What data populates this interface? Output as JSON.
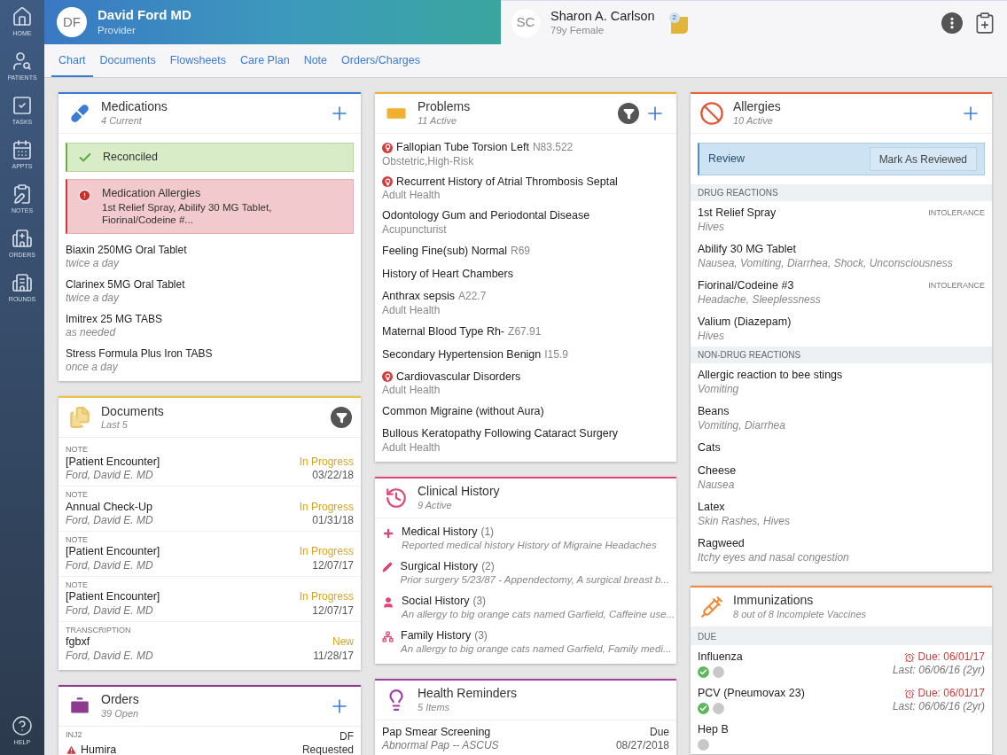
{
  "nav": {
    "items": [
      {
        "label": "HOME",
        "kind": "home"
      },
      {
        "label": "PATIENTS",
        "kind": "patients"
      },
      {
        "label": "TASKS",
        "kind": "tasks"
      },
      {
        "label": "APPTS",
        "kind": "appts"
      },
      {
        "label": "NOTES",
        "kind": "notes"
      },
      {
        "label": "ORDERS",
        "kind": "orders"
      },
      {
        "label": "ROUNDS",
        "kind": "rounds"
      }
    ],
    "help": "HELP"
  },
  "provider": {
    "initials": "DF",
    "name": "David Ford MD",
    "role": "Provider"
  },
  "patient": {
    "initials": "SC",
    "name": "Sharon A. Carlson",
    "info": "79y Female",
    "note_count": "2"
  },
  "tabs": [
    {
      "label": "Chart",
      "selected": true
    },
    {
      "label": "Documents",
      "selected": false
    },
    {
      "label": "Flowsheets",
      "selected": false
    },
    {
      "label": "Care Plan",
      "selected": false
    },
    {
      "label": "Note",
      "selected": false
    },
    {
      "label": "Orders/Charges",
      "selected": false
    }
  ],
  "medications": {
    "title": "Medications",
    "subtitle": "4 Current",
    "banners": [
      {
        "kind": "success",
        "title": "Reconciled"
      },
      {
        "kind": "alert",
        "title": "Medication Allergies",
        "text": "1st Relief Spray, Abilify 30 MG Tablet, Fiorinal/Codeine #..."
      }
    ],
    "items": [
      {
        "name": "Biaxin 250MG Oral Tablet",
        "sig": "twice a day"
      },
      {
        "name": "Clarinex 5MG Oral Tablet",
        "sig": "twice a day"
      },
      {
        "name": "Imitrex 25 MG TABS",
        "sig": "as needed"
      },
      {
        "name": "Stress Formula Plus Iron TABS",
        "sig": "once a day"
      }
    ]
  },
  "documents": {
    "title": "Documents",
    "subtitle": "Last 5",
    "items": [
      {
        "type": "NOTE",
        "title": "[Patient Encounter]",
        "status": "In Progress",
        "author": "Ford, David E. MD",
        "date": "03/22/18"
      },
      {
        "type": "NOTE",
        "title": "Annual Check-Up",
        "status": "In Progress",
        "author": "Ford, David E. MD",
        "date": "01/31/18"
      },
      {
        "type": "NOTE",
        "title": "[Patient Encounter]",
        "status": "In Progress",
        "author": "Ford, David E. MD",
        "date": "12/07/17"
      },
      {
        "type": "NOTE",
        "title": "[Patient Encounter]",
        "status": "In Progress",
        "author": "Ford, David E. MD",
        "date": "12/07/17"
      },
      {
        "type": "TRANSCRIPTION",
        "title": "fgbxf",
        "status": "New",
        "author": "Ford, David E. MD",
        "date": "11/28/17"
      }
    ]
  },
  "orders": {
    "title": "Orders",
    "subtitle": "39 Open",
    "items": [
      {
        "type": "INJ2",
        "initials": "DF",
        "name": "Humira",
        "status": "Requested"
      }
    ]
  },
  "problems": {
    "title": "Problems",
    "subtitle": "11 Active",
    "items": [
      {
        "name": "Fallopian Tube Torsion Left",
        "code": "N83.522",
        "category": "Obstetric,High-Risk",
        "flagged": true
      },
      {
        "name": "Recurrent History of Atrial Thrombosis Septal",
        "category": "Adult Health",
        "flagged": true
      },
      {
        "name": "Odontology Gum and Periodontal Disease",
        "category": "Acupuncturist",
        "flagged": false
      },
      {
        "name": "Feeling Fine(sub) Normal",
        "code": "R69",
        "flagged": false
      },
      {
        "name": "History of Heart Chambers",
        "flagged": false
      },
      {
        "name": "Anthrax sepsis",
        "code": "A22.7",
        "category": "Adult Health",
        "flagged": false
      },
      {
        "name": "Maternal Blood Type Rh-",
        "code": "Z67.91",
        "flagged": false
      },
      {
        "name": "Secondary Hypertension Benign",
        "code": "I15.9",
        "flagged": false
      },
      {
        "name": "Cardiovascular Disorders",
        "category": "Adult Health",
        "flagged": true
      },
      {
        "name": "Common Migraine (without Aura)",
        "flagged": false
      },
      {
        "name": "Bullous Keratopathy Following Cataract Surgery",
        "category": "Adult Health",
        "flagged": false
      }
    ]
  },
  "clinical_history": {
    "title": "Clinical History",
    "subtitle": "9 Active",
    "items": [
      {
        "kind": "medical",
        "name": "Medical History",
        "count": "(1)",
        "detail": "Reported medical history History of Migraine Headaches"
      },
      {
        "kind": "surgical",
        "name": "Surgical History",
        "count": "(2)",
        "detail": "Prior surgery 5/23/87 - Appendectomy, A surgical breast b..."
      },
      {
        "kind": "social",
        "name": "Social History",
        "count": "(3)",
        "detail": "An allergy to big orange cats named Garfield, Caffeine use..."
      },
      {
        "kind": "family",
        "name": "Family History",
        "count": "(3)",
        "detail": "An allergy to big orange cats named Garfield, Family medi..."
      }
    ]
  },
  "health_reminders": {
    "title": "Health Reminders",
    "subtitle": "5 Items",
    "items": [
      {
        "name": "Pap Smear Screening",
        "status": "Due",
        "detail": "Abnormal Pap -- ASCUS",
        "date": "08/27/2018"
      }
    ]
  },
  "allergies": {
    "title": "Allergies",
    "subtitle": "10 Active",
    "review": {
      "label": "Review",
      "button": "Mark As Reviewed"
    },
    "groups": [
      {
        "heading": "DRUG REACTIONS",
        "items": [
          {
            "name": "1st Relief Spray",
            "reaction": "Hives",
            "tag": "INTOLERANCE"
          },
          {
            "name": "Abilify 30 MG Tablet",
            "reaction": "Nausea, Vomiting, Diarrhea, Shock, Unconsciousness"
          },
          {
            "name": "Fiorinal/Codeine #3",
            "reaction": "Headache, Sleeplessness",
            "tag": "INTOLERANCE"
          },
          {
            "name": "Valium (Diazepam)",
            "reaction": "Hives"
          }
        ]
      },
      {
        "heading": "NON-DRUG REACTIONS",
        "items": [
          {
            "name": "Allergic reaction to bee stings",
            "reaction": "Vomiting"
          },
          {
            "name": "Beans",
            "reaction": "Vomiting, Diarrhea"
          },
          {
            "name": "Cats"
          },
          {
            "name": "Cheese",
            "reaction": "Nausea"
          },
          {
            "name": "Latex",
            "reaction": "Skin Rashes, Hives"
          },
          {
            "name": "Ragweed",
            "reaction": "Itchy eyes and nasal congestion"
          }
        ]
      }
    ]
  },
  "immunizations": {
    "title": "Immunizations",
    "subtitle": "8 out of 8 Incomplete Vaccines",
    "heading": "DUE",
    "items": [
      {
        "name": "Influenza",
        "due": "Due: 06/01/17",
        "last": "Last: 06/06/16 (2yr)",
        "doses": [
          {
            "given": true
          },
          {
            "given": false
          }
        ]
      },
      {
        "name": "PCV (Pneumovax 23)",
        "due": "Due: 06/01/17",
        "last": "Last: 06/06/16 (2yr)",
        "doses": [
          {
            "given": true
          },
          {
            "given": false
          }
        ]
      },
      {
        "name": "Hep B",
        "doses": [
          {
            "given": false
          }
        ]
      }
    ]
  }
}
